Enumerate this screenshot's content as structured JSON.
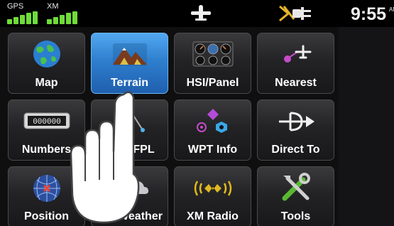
{
  "status_bar": {
    "gps_label": "GPS",
    "xm_label": "XM",
    "time": "9:55",
    "time_suffix": "AM",
    "signal_color": "#6fdc3a"
  },
  "tiles": [
    {
      "label": "Map",
      "icon": "globe-icon",
      "active": false
    },
    {
      "label": "Terrain",
      "icon": "terrain-mountains-icon",
      "active": true
    },
    {
      "label": "HSI/Panel",
      "icon": "instrument-panel-icon",
      "active": false
    },
    {
      "label": "Nearest",
      "icon": "nearest-airplane-icon",
      "active": false
    },
    {
      "label": "Numbers",
      "icon": "odometer-icon",
      "active": false
    },
    {
      "label": "FPL",
      "icon": "flight-plan-icon",
      "active": false
    },
    {
      "label": "WPT Info",
      "icon": "waypoint-icon",
      "active": false
    },
    {
      "label": "Direct To",
      "icon": "direct-to-icon",
      "active": false
    },
    {
      "label": "Position",
      "icon": "position-grid-icon",
      "active": false
    },
    {
      "label": "Weather",
      "icon": "weather-cloud-icon",
      "active": false
    },
    {
      "label": "XM Radio",
      "icon": "xm-radio-icon",
      "active": false
    },
    {
      "label": "Tools",
      "icon": "tools-icon",
      "active": false
    }
  ],
  "odometer_text": "000000",
  "colors": {
    "active_tile": "#2f7fcf",
    "tile": "#232325",
    "background": "#0f0f10"
  }
}
